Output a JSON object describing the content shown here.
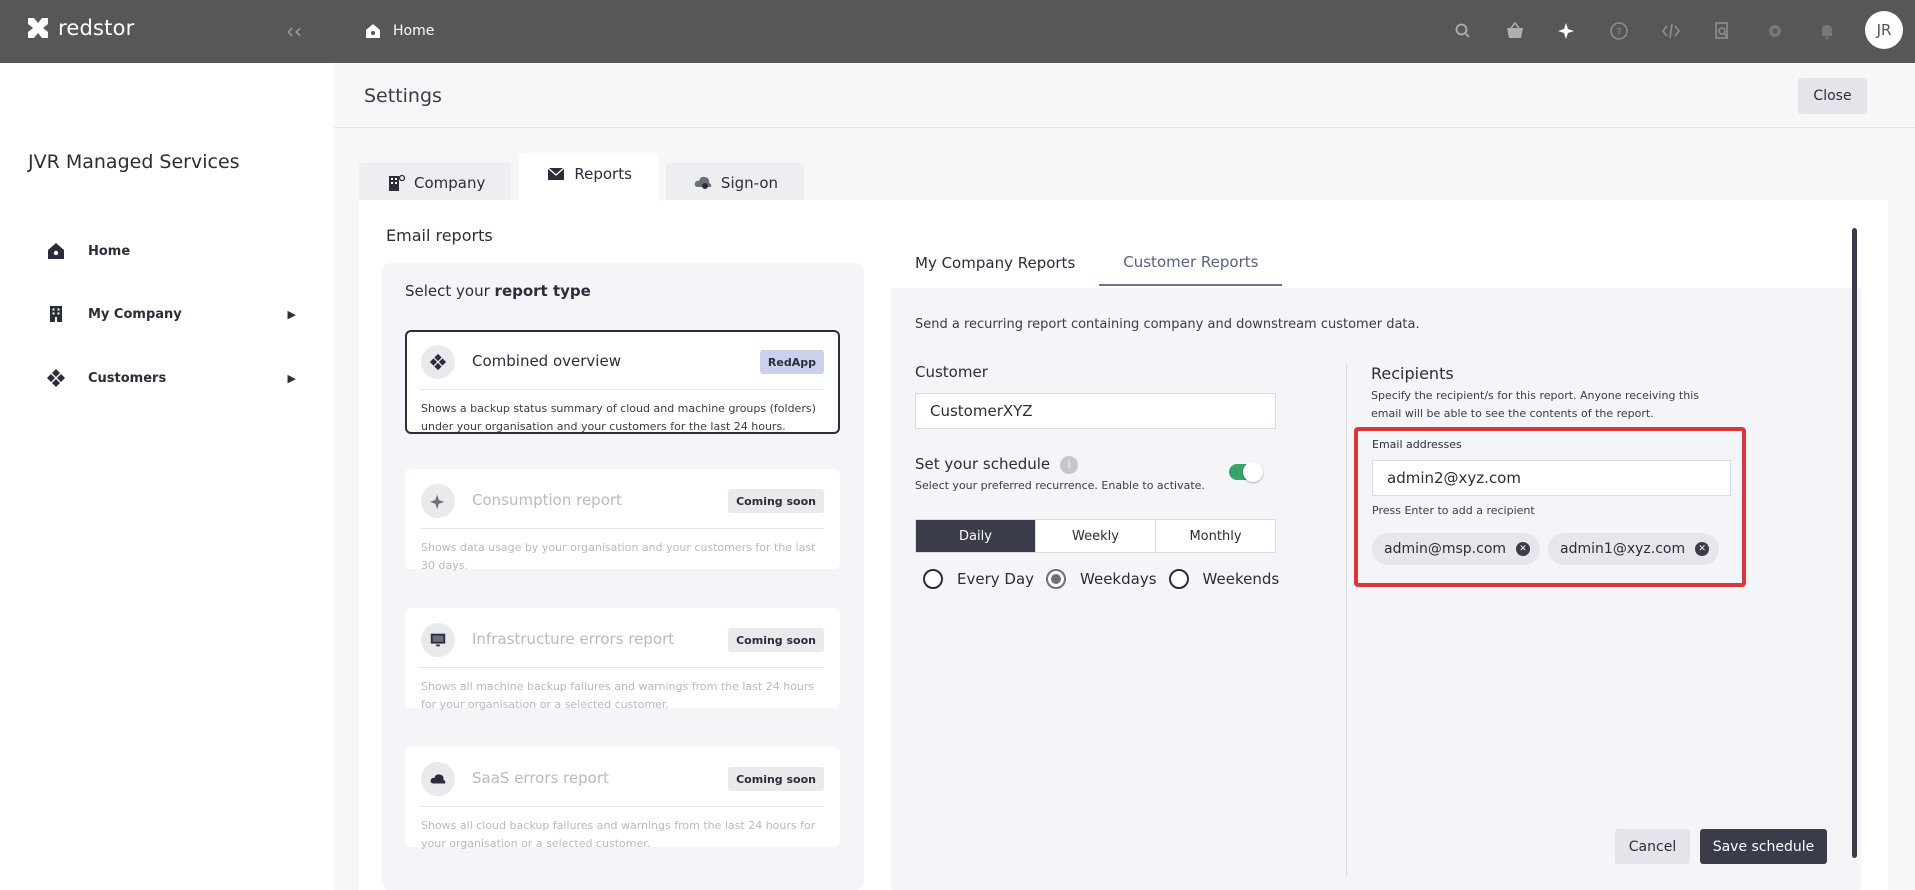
{
  "app": {
    "brand": "redstor"
  },
  "topbar": {
    "breadcrumb": "Home",
    "icons": [
      "search-icon",
      "basket-icon",
      "sparkle-icon",
      "help-icon",
      "code-icon",
      "search-doc-icon",
      "settings-icon",
      "bell-icon"
    ],
    "avatar_initials": "JR"
  },
  "sidebar": {
    "org_name": "JVR Managed Services",
    "items": [
      {
        "label": "Home"
      },
      {
        "label": "My Company"
      },
      {
        "label": "Customers"
      }
    ]
  },
  "settings": {
    "title": "Settings",
    "close_label": "Close",
    "tabs": [
      {
        "label": "Company"
      },
      {
        "label": "Reports"
      },
      {
        "label": "Sign-on"
      }
    ],
    "section_title": "Email reports"
  },
  "report_type": {
    "title_prefix": "Select your ",
    "title_bold": "report type",
    "cards": [
      {
        "title": "Combined overview",
        "badge": "RedApp",
        "desc": "Shows a backup status summary of cloud and machine groups (folders) under your organisation and your customers for the last 24 hours."
      },
      {
        "title": "Consumption report",
        "badge": "Coming soon",
        "desc": "Shows data usage by your organisation and your customers for the last 30 days."
      },
      {
        "title": "Infrastructure errors report",
        "badge": "Coming soon",
        "desc": "Shows all machine backup failures and warnings from the last 24 hours for your organisation or a selected customer."
      },
      {
        "title": "SaaS errors report",
        "badge": "Coming soon",
        "desc": "Shows all cloud backup failures and warnings from the last 24 hours for your organisation or a selected customer."
      }
    ]
  },
  "report_tabs": [
    {
      "label": "My Company Reports"
    },
    {
      "label": "Customer Reports"
    }
  ],
  "customer_reports": {
    "description": "Send a recurring report containing company and downstream customer data.",
    "customer_label": "Customer",
    "customer_value": "CustomerXYZ",
    "schedule_label": "Set your schedule",
    "schedule_info": "i",
    "schedule_hint": "Select your preferred recurrence. Enable to activate.",
    "schedule_enabled": true,
    "frequency": [
      "Daily",
      "Weekly",
      "Monthly"
    ],
    "frequency_selected": "Daily",
    "day_options": [
      "Every Day",
      "Weekdays",
      "Weekends"
    ],
    "day_selected": "Weekdays",
    "recipients_title": "Recipients",
    "recipients_desc": "Specify the recipient/s for this report. Anyone receiving this email will be able to see the contents of the report.",
    "email_label": "Email addresses",
    "email_input_value": "admin2@xyz.com",
    "email_hint": "Press Enter to add a recipient",
    "recipients": [
      "admin@msp.com",
      "admin1@xyz.com"
    ],
    "cancel_label": "Cancel",
    "save_label": "Save schedule"
  },
  "colors": {
    "topbar": "#575757",
    "accent_dark": "#3a3c4a",
    "highlight_border": "#d9373c",
    "toggle_on": "#3aa26b",
    "badge_redapp": "#c9d1ed"
  }
}
